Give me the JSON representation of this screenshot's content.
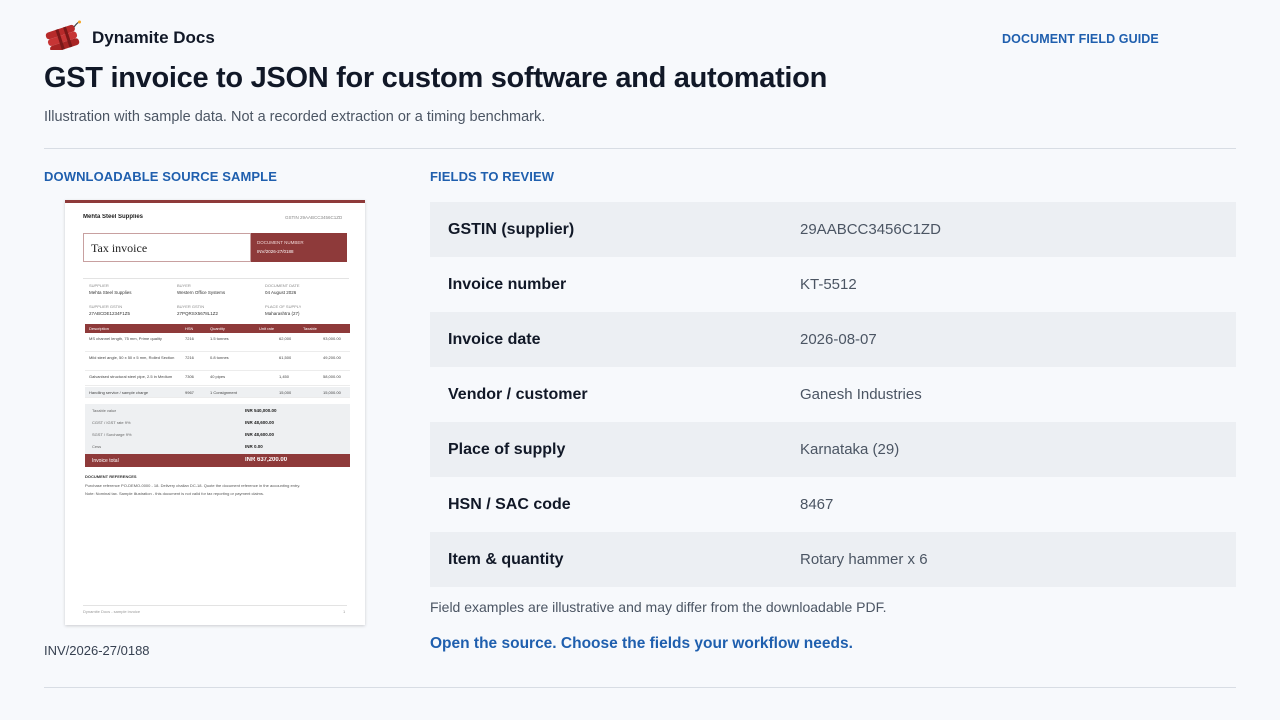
{
  "brand": {
    "name": "Dynamite Docs",
    "logo_icon": "dynamite-sticks-icon",
    "accent_color": "#1f5fae",
    "logo_color": "#b72a2a"
  },
  "header": {
    "nav_link": "DOCUMENT FIELD GUIDE",
    "title": "GST invoice to JSON for custom software and automation",
    "subtitle": "Illustration with sample data. Not a recorded extraction or a timing benchmark."
  },
  "source": {
    "heading": "DOWNLOADABLE SOURCE SAMPLE",
    "reference": "INV/2026-27/0188",
    "preview": {
      "seller": "Mehta Steel Supplies",
      "seller_meta": "GSTIN 29AABCC3456C1ZD",
      "doc_title": "Tax invoice",
      "doc_number_label": "DOCUMENT NUMBER",
      "doc_number": "INV/2026-27/0188",
      "supplier_label": "SUPPLIER",
      "supplier": "Mehta Steel Supplies",
      "buyer_label": "BUYER",
      "buyer": "Western Office Systems",
      "date_label": "DOCUMENT DATE",
      "date": "04 August 2026",
      "supplier_gstin_label": "SUPPLIER GSTIN",
      "supplier_gstin": "27ABCDE1234F1Z5",
      "buyer_gstin_label": "BUYER GSTIN",
      "buyer_gstin": "27PQRSX5678L1Z2",
      "pos_label": "PLACE OF SUPPLY",
      "pos": "Maharashtra (27)",
      "columns": [
        "Description",
        "HSN",
        "Quantity",
        "Unit rate",
        "Taxable"
      ],
      "rows": [
        {
          "desc": "MS channel length, 75 mm, Prime quality",
          "hsn": "7216",
          "qty": "1.5 tonnes",
          "rate": "62,000",
          "taxable": "93,000.00"
        },
        {
          "desc": "Mild steel angle, 50 x 50 x 5 mm, Rolled Section",
          "hsn": "7216",
          "qty": "0.8 tonnes",
          "rate": "61,500",
          "taxable": "49,200.00"
        },
        {
          "desc": "Galvanised structural steel pipe, 2.5 in Medium",
          "hsn": "7306",
          "qty": "40 pipes",
          "rate": "1,450",
          "taxable": "58,000.00"
        },
        {
          "desc": "Handling service / sample charge",
          "hsn": "9967",
          "qty": "1 Consignment",
          "rate": "15,000",
          "taxable": "15,000.00"
        }
      ],
      "summary": [
        {
          "label": "Taxable value",
          "value": "INR 540,000.00"
        },
        {
          "label": "CGST / IGST rate 9%",
          "value": "INR 48,600.00"
        },
        {
          "label": "SGST / Surcharge 9%",
          "value": "INR 48,600.00"
        },
        {
          "label": "Cess",
          "value": "INR 0.00"
        }
      ],
      "total_label": "Invoice total",
      "total_value": "INR 637,200.00",
      "notes_heading": "DOCUMENT REFERENCES",
      "notes": [
        "Purchase reference PO-DEMO-0000 - 18. Delivery challan DC-18. Quote the document reference in the accounting entry.",
        "Note: Nominal tax. Sample illustration - this document is not valid for tax reporting or payment claims."
      ],
      "footer": "Dynamite Docs - sample invoice",
      "page": "1"
    }
  },
  "fields": {
    "heading": "FIELDS TO REVIEW",
    "rows": [
      {
        "label": "GSTIN (supplier)",
        "value": "29AABCC3456C1ZD"
      },
      {
        "label": "Invoice number",
        "value": "KT-5512"
      },
      {
        "label": "Invoice date",
        "value": "2026-08-07"
      },
      {
        "label": "Vendor / customer",
        "value": "Ganesh Industries"
      },
      {
        "label": "Place of supply",
        "value": "Karnataka (29)"
      },
      {
        "label": "HSN / SAC code",
        "value": "8467"
      },
      {
        "label": "Item & quantity",
        "value": "Rotary hammer x 6"
      }
    ],
    "disclaimer": "Field examples are illustrative and may differ from the downloadable PDF.",
    "cta": "Open the source. Choose the fields your workflow needs."
  }
}
